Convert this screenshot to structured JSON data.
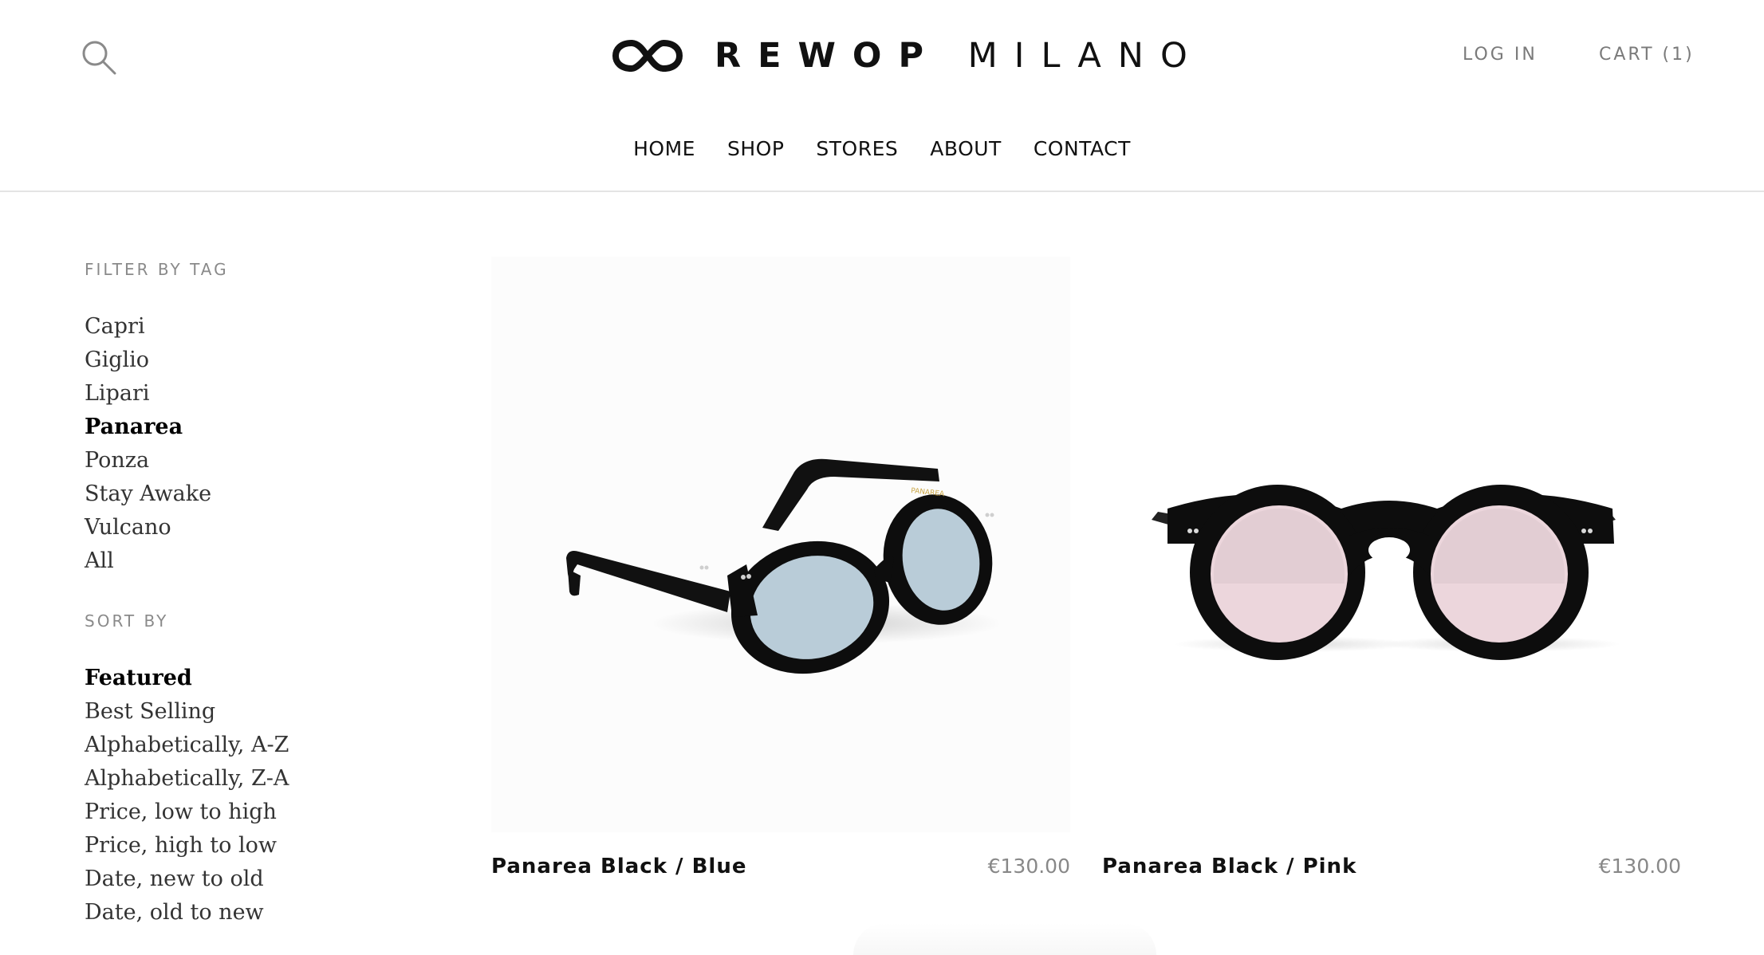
{
  "header": {
    "brand_bold": "REWOP",
    "brand_light": "MILANO",
    "login_label": "LOG IN",
    "cart_label": "CART (1)"
  },
  "nav": {
    "items": [
      {
        "label": "HOME"
      },
      {
        "label": "SHOP"
      },
      {
        "label": "STORES"
      },
      {
        "label": "ABOUT"
      },
      {
        "label": "CONTACT"
      }
    ]
  },
  "sidebar": {
    "filter_heading": "FILTER BY TAG",
    "tags": [
      {
        "label": "Capri",
        "active": false
      },
      {
        "label": "Giglio",
        "active": false
      },
      {
        "label": "Lipari",
        "active": false
      },
      {
        "label": "Panarea",
        "active": true
      },
      {
        "label": "Ponza",
        "active": false
      },
      {
        "label": "Stay Awake",
        "active": false
      },
      {
        "label": "Vulcano",
        "active": false
      },
      {
        "label": "All",
        "active": false
      }
    ],
    "sort_heading": "SORT BY",
    "sort_options": [
      {
        "label": "Featured",
        "active": true
      },
      {
        "label": "Best Selling",
        "active": false
      },
      {
        "label": "Alphabetically, A-Z",
        "active": false
      },
      {
        "label": "Alphabetically, Z-A",
        "active": false
      },
      {
        "label": "Price, low to high",
        "active": false
      },
      {
        "label": "Price, high to low",
        "active": false
      },
      {
        "label": "Date, new to old",
        "active": false
      },
      {
        "label": "Date, old to new",
        "active": false
      }
    ]
  },
  "products": [
    {
      "name": "Panarea Black / Blue",
      "price": "€130.00",
      "lens_color": "#b9ccd8",
      "frame_color": "#0d0d0d",
      "temple_text": "PANAREA"
    },
    {
      "name": "Panarea Black / Pink",
      "price": "€130.00",
      "lens_color": "#ecd6dc",
      "frame_color": "#0d0d0d"
    }
  ],
  "icons": {
    "search": "search-icon",
    "logo": "infinity-logo-icon"
  }
}
